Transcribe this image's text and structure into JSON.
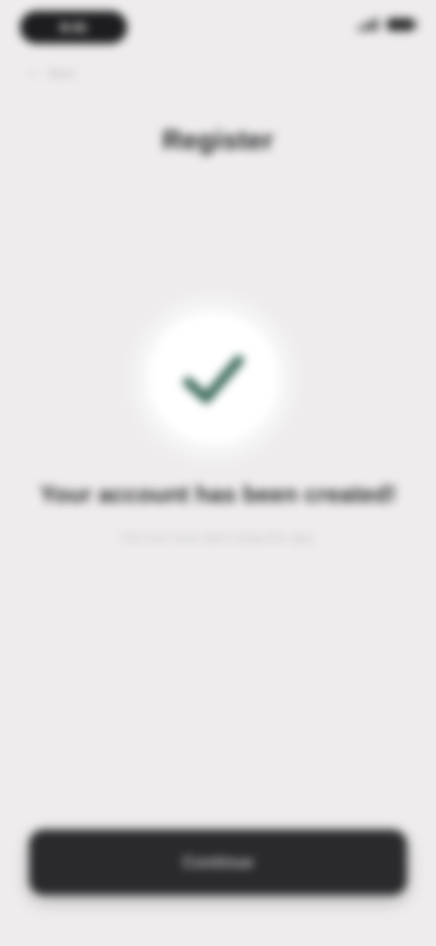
{
  "status_bar": {
    "time": "9:41",
    "icons": [
      "signal-icon",
      "battery-icon"
    ]
  },
  "nav": {
    "back_label": "Back",
    "back_icon": "chevron-left-icon"
  },
  "header": {
    "title": "Register"
  },
  "confirmation": {
    "icon": "checkmark-icon",
    "title": "Your account has been created!",
    "subtitle": "You can now start using the app."
  },
  "footer": {
    "continue_label": "Continue"
  },
  "colors": {
    "background": "#eeeced",
    "button": "#2a2a2c",
    "check": "#3e6b5b",
    "status_pill": "#1d1d1f"
  }
}
